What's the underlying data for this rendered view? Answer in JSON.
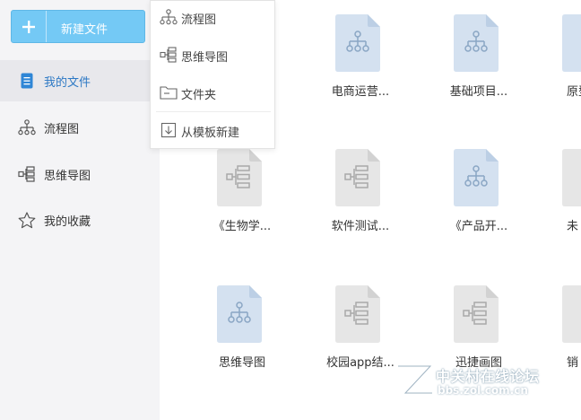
{
  "new_button": {
    "label": "新建文件",
    "icon": "plus-icon"
  },
  "sidebar": {
    "items": [
      {
        "label": "我的文件",
        "icon": "document-icon",
        "active": true
      },
      {
        "label": "流程图",
        "icon": "flowchart-icon"
      },
      {
        "label": "思维导图",
        "icon": "mindmap-icon"
      },
      {
        "label": "我的收藏",
        "icon": "star-icon"
      }
    ]
  },
  "dropdown": {
    "items": [
      {
        "label": "流程图",
        "icon": "flowchart-icon"
      },
      {
        "label": "思维导图",
        "icon": "mindmap-icon"
      },
      {
        "label": "文件夹",
        "icon": "folder-icon"
      },
      {
        "label": "从模板新建",
        "icon": "template-icon"
      }
    ]
  },
  "files": [
    {
      "name": "电商运营...",
      "type": "flowchart"
    },
    {
      "name": "基础项目...",
      "type": "flowchart"
    },
    {
      "name": "原型",
      "type": "flowchart"
    },
    {
      "name": "《生物学...",
      "type": "mindmap"
    },
    {
      "name": "软件测试...",
      "type": "mindmap"
    },
    {
      "name": "《产品开...",
      "type": "flowchart"
    },
    {
      "name": "未",
      "type": "mindmap"
    },
    {
      "name": "思维导图",
      "type": "flowchart"
    },
    {
      "name": "校园app结...",
      "type": "mindmap"
    },
    {
      "name": "迅捷画图",
      "type": "mindmap"
    },
    {
      "name": "销",
      "type": "mindmap"
    }
  ],
  "colors": {
    "accent": "#74c9f5",
    "active_text": "#2c78c4",
    "flowchart_doc": "#d4e1f0",
    "mindmap_doc": "#e6e6e6"
  },
  "watermark": {
    "cn": "中关村在线论坛",
    "en": "bbs.zol.com.cn"
  }
}
